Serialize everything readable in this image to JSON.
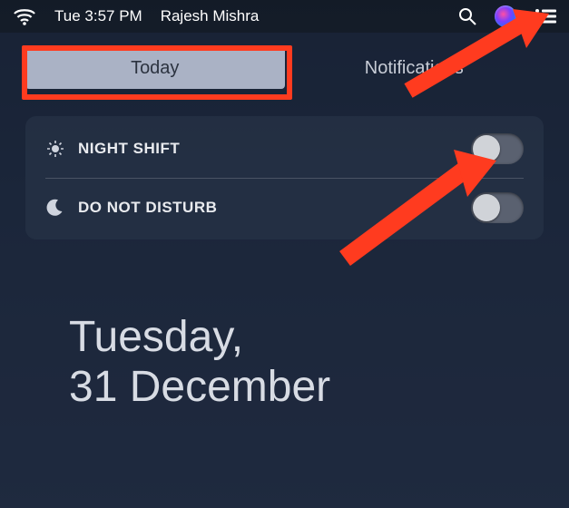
{
  "menubar": {
    "datetime": "Tue 3:57 PM",
    "username": "Rajesh Mishra"
  },
  "tabs": {
    "today": "Today",
    "notifications": "Notifications"
  },
  "settings": {
    "night_shift": {
      "label": "NIGHT SHIFT",
      "enabled": false
    },
    "dnd": {
      "label": "DO NOT DISTURB",
      "enabled": false
    }
  },
  "date": {
    "weekday": "Tuesday,",
    "day_month": "31 December"
  },
  "colors": {
    "highlight": "#ff3b1f"
  }
}
